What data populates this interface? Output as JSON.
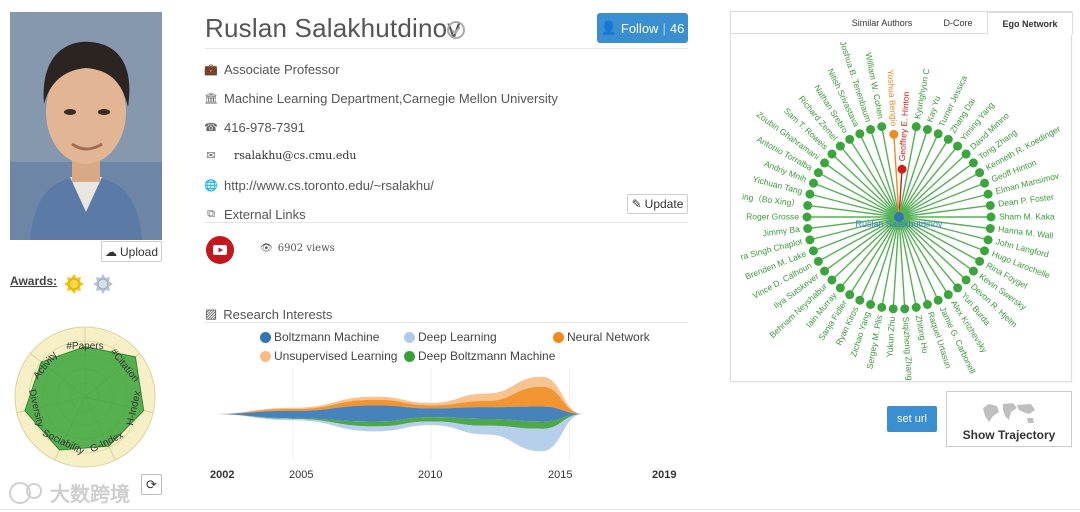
{
  "profile": {
    "name": "Ruslan Salakhutdinov",
    "follow_label": "Follow",
    "follow_count": "46",
    "position": "Associate Professor",
    "affiliation": "Machine Learning Department,Carnegie Mellon University",
    "phone": "416-978-7391",
    "email": "rsalakhu@cs.cmu.edu",
    "homepage": "http://www.cs.toronto.edu/~rsalakhu/",
    "external_links_label": "External Links",
    "update_label": "Update",
    "views": "6902 views",
    "upload_label": "Upload",
    "awards_label": "Awards:"
  },
  "radar": {
    "axes": [
      "#Papers",
      "#Citation",
      "H-Index",
      "G-Index",
      "Sociability",
      "Diversity",
      "Activity"
    ],
    "values": [
      0.72,
      0.92,
      0.86,
      0.78,
      0.84,
      0.88,
      0.8
    ],
    "fill_color": "#3aa53a"
  },
  "research": {
    "title": "Research Interests",
    "legend": [
      {
        "name": "Boltzmann Machine",
        "color": "#3176b3"
      },
      {
        "name": "Deep Learning",
        "color": "#aecbe9"
      },
      {
        "name": "Neural Network",
        "color": "#f08a1c"
      },
      {
        "name": "Unsupervised Learning",
        "color": "#f6bd84"
      },
      {
        "name": "Deep Boltzmann Machine",
        "color": "#3a9f3a"
      }
    ],
    "axis_start": "2002",
    "axis_end": "2019",
    "ticks": [
      "2005",
      "2010",
      "2015"
    ]
  },
  "chart_data": {
    "type": "area",
    "x": [
      2002,
      2005,
      2008,
      2010,
      2012,
      2014,
      2015.5
    ],
    "series": [
      {
        "name": "Boltzmann Machine",
        "values": [
          0,
          1.2,
          2.6,
          1.4,
          1.9,
          2.4,
          0
        ]
      },
      {
        "name": "Deep Learning",
        "values": [
          0,
          0.2,
          0.8,
          0.6,
          1.4,
          3.6,
          0
        ]
      },
      {
        "name": "Neural Network",
        "values": [
          0,
          0.3,
          0.9,
          0.5,
          1.0,
          3.2,
          0
        ]
      },
      {
        "name": "Unsupervised Learning",
        "values": [
          0,
          0.2,
          0.5,
          0.4,
          1.2,
          1.6,
          0
        ]
      },
      {
        "name": "Deep Boltzmann Machine",
        "values": [
          0,
          0.1,
          0.8,
          0.7,
          1.1,
          1.2,
          0
        ]
      }
    ],
    "xlim": [
      2002,
      2019
    ]
  },
  "network": {
    "tabs": [
      "Similar Authors",
      "D-Core",
      "Ego Network"
    ],
    "active_tab": "Ego Network",
    "center": "Ruslan Salakhutdinov",
    "highlight_orange": "Yoshua Bengio",
    "highlight_red": "Geoffrey E. Hinton",
    "nodes": [
      "Geoffrey E. Hinton",
      "Kyunghyun C",
      "Kay Yu",
      "Turner Jessica",
      "Zhang Dai",
      "Yiming Yang",
      "David Mimno",
      "Tong Zhang",
      "Kenneth R. Koedinger",
      "Geoff Hinton",
      "Elman Mansimov",
      "Dean P. Foster",
      "Sham M. Kaka",
      "Hanna M. Wall",
      "John Langford",
      "Hugo Larochelle",
      "Rina Foygel",
      "Kevin Swersky",
      "Devon R. Hjelm",
      "Yuri Burda",
      "Alex Krizhevsky",
      "Jamie G. Carbonell",
      "Raquel Urtasun",
      "Zhiting Hu",
      "Siqizheng Zhang",
      "Yukun Zhu",
      "Sergey M. Plis",
      "Zichao Yang",
      "Ryan Kiros",
      "Sanja Fidler",
      "Iain Murray",
      "Behnam Neyshabur",
      "Ilya Sutskever",
      "Vince D. Calhoun",
      "Brenden M. Lake",
      "ra Singh Chaplot",
      "Jimmy Ba",
      "Roger Grosse",
      "ing（Bo Xing）",
      "Yichuan Tang",
      "Andriy Mnih",
      "Antonio Torralba",
      "Zoubin Ghahramani",
      "Sam T. Roweis",
      "Richard Zemel",
      "Nathan Srebro",
      "Nitish Srivastava",
      "Joshua B. Tenenbaum",
      "William W. Cohen",
      "Yoshua Bengio"
    ],
    "seturl_label": "set url",
    "trajectory_label": "Show Trajectory"
  },
  "watermark": "大数跨境"
}
